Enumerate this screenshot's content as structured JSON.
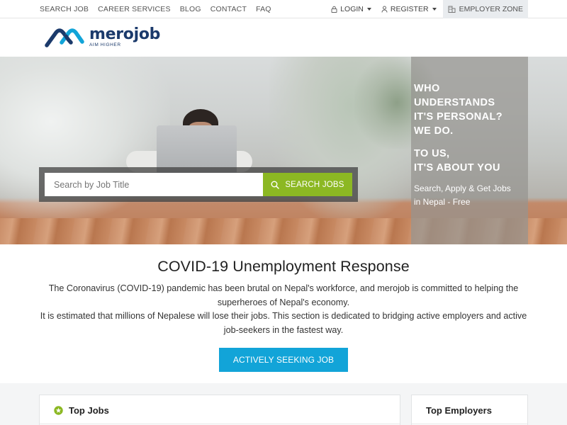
{
  "topnav": {
    "items": [
      "SEARCH JOB",
      "CAREER SERVICES",
      "BLOG",
      "CONTACT",
      "FAQ"
    ],
    "login": "LOGIN",
    "register": "REGISTER",
    "employer_zone": "EMPLOYER ZONE"
  },
  "brand": {
    "name": "merojob",
    "tagline": "AIM HIGHER",
    "color": "#1b3a6b"
  },
  "hero": {
    "search_placeholder": "Search by Job Title",
    "search_button": "SEARCH JOBS",
    "headline_lines": [
      "WHO",
      "UNDERSTANDS",
      "IT'S PERSONAL?",
      "WE DO."
    ],
    "headline2_lines": [
      "TO US,",
      "IT'S ABOUT YOU"
    ],
    "subtext_lines": [
      "Search, Apply & Get Jobs",
      "in Nepal - Free"
    ],
    "button_color": "#8cb823"
  },
  "covid": {
    "title": "COVID-19 Unemployment Response",
    "paragraph1": "The Coronavirus (COVID-19) pandemic has been brutal on Nepal's workforce, and merojob is committed to helping the superheroes of Nepal's economy.",
    "paragraph2": "It is estimated that millions of Nepalese will lose their jobs. This section is dedicated to bridging active employers and active job-seekers in the fastest way.",
    "button": "ACTIVELY SEEKING JOB",
    "button_color": "#12a4d8"
  },
  "sections": {
    "top_jobs": "Top Jobs",
    "top_employers": "Top Employers",
    "star_color": "#8cb823"
  },
  "icons": {
    "login": "lock-icon",
    "register": "user-icon",
    "employer": "building-icon",
    "search": "search-icon",
    "star": "star-icon"
  }
}
